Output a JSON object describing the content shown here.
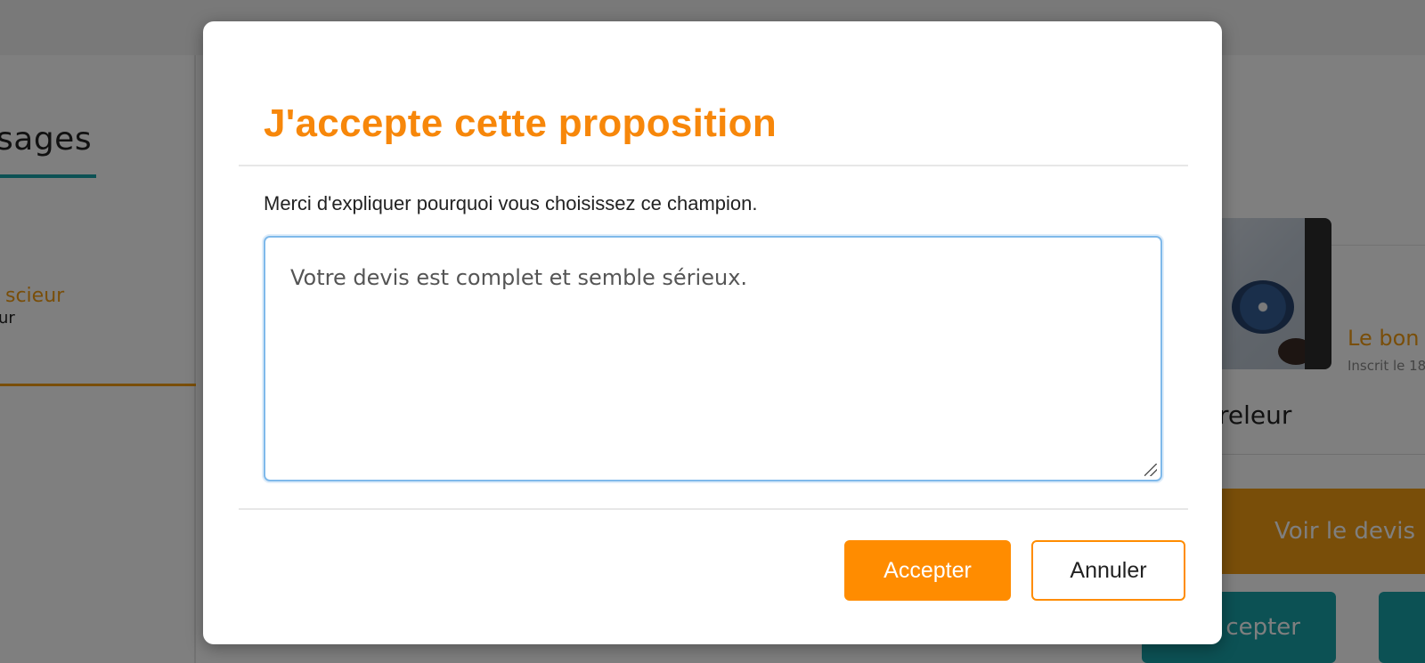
{
  "background": {
    "messages_tab": "sages",
    "thread": {
      "name": "scieur",
      "subtitle": "ur"
    },
    "seller": {
      "name": "Le bon",
      "registered": "Inscrit le 18"
    },
    "job": "releur",
    "quote_button": "Voir le devis",
    "accept_button": "cepter"
  },
  "modal": {
    "title": "J'accepte cette proposition",
    "label": "Merci d'expliquer pourquoi vous choisissez ce champion.",
    "textarea_value": "Votre devis est complet et semble sérieux.",
    "accept_label": "Accepter",
    "cancel_label": "Annuler"
  },
  "colors": {
    "accent": "#ff8c00",
    "title": "#f7870a",
    "teal": "#18a3a9",
    "focus_border": "#7fb9ea"
  },
  "icons": {
    "resize_grip": "resize-grip-icon"
  }
}
